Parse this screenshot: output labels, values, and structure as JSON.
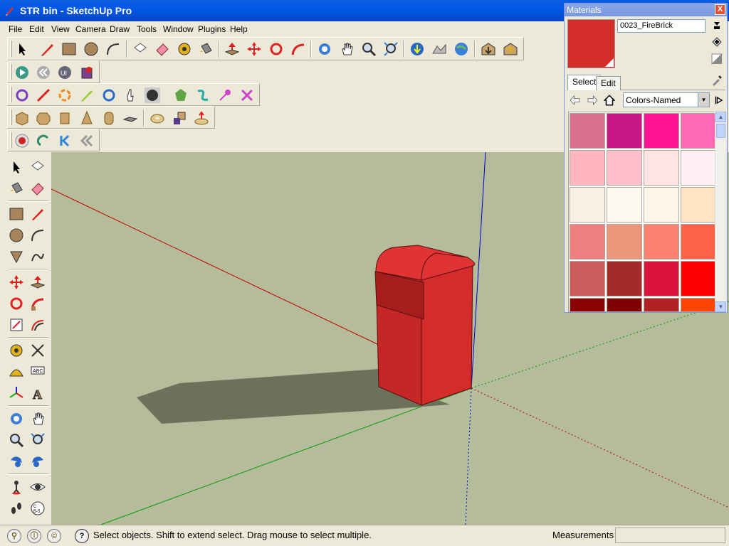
{
  "window": {
    "title": "STR bin - SketchUp Pro"
  },
  "menu": [
    "File",
    "Edit",
    "View",
    "Camera",
    "Draw",
    "Tools",
    "Window",
    "Plugins",
    "Help"
  ],
  "status": {
    "hint": "Select objects. Shift to extend select. Drag mouse to select multiple.",
    "measurements_label": "Measurements",
    "measurements_value": ""
  },
  "materials": {
    "title": "Materials",
    "close_label": "X",
    "current_name": "0023_FireBrick",
    "current_color": "#d42b2b",
    "tabs": [
      "Select",
      "Edit"
    ],
    "collection": "Colors-Named",
    "swatches": [
      [
        "#d9708f",
        "#c71585",
        "#ff1493",
        "#ff69b4"
      ],
      [
        "#ffb6c1",
        "#ffc0cb",
        "#ffe4e1",
        "#fff0f5"
      ],
      [
        "#faf0e6",
        "#fffaf0",
        "#fdf5e6",
        "#ffe4c4"
      ],
      [
        "#f08080",
        "#e9967a",
        "#fa8072",
        "#ff6347"
      ],
      [
        "#cd5c5c",
        "#a52a2a",
        "#dc143c",
        "#ff0000"
      ],
      [
        "#8b0000",
        "#800000",
        "#b22222",
        "#ff4500"
      ]
    ]
  },
  "colors": {
    "viewport_bg": "#b4bc9c",
    "object_red": "#d42b2b",
    "shadow": "#6b7259",
    "axis_red": "#c00000",
    "axis_green": "#009900",
    "axis_blue": "#0000cc"
  }
}
